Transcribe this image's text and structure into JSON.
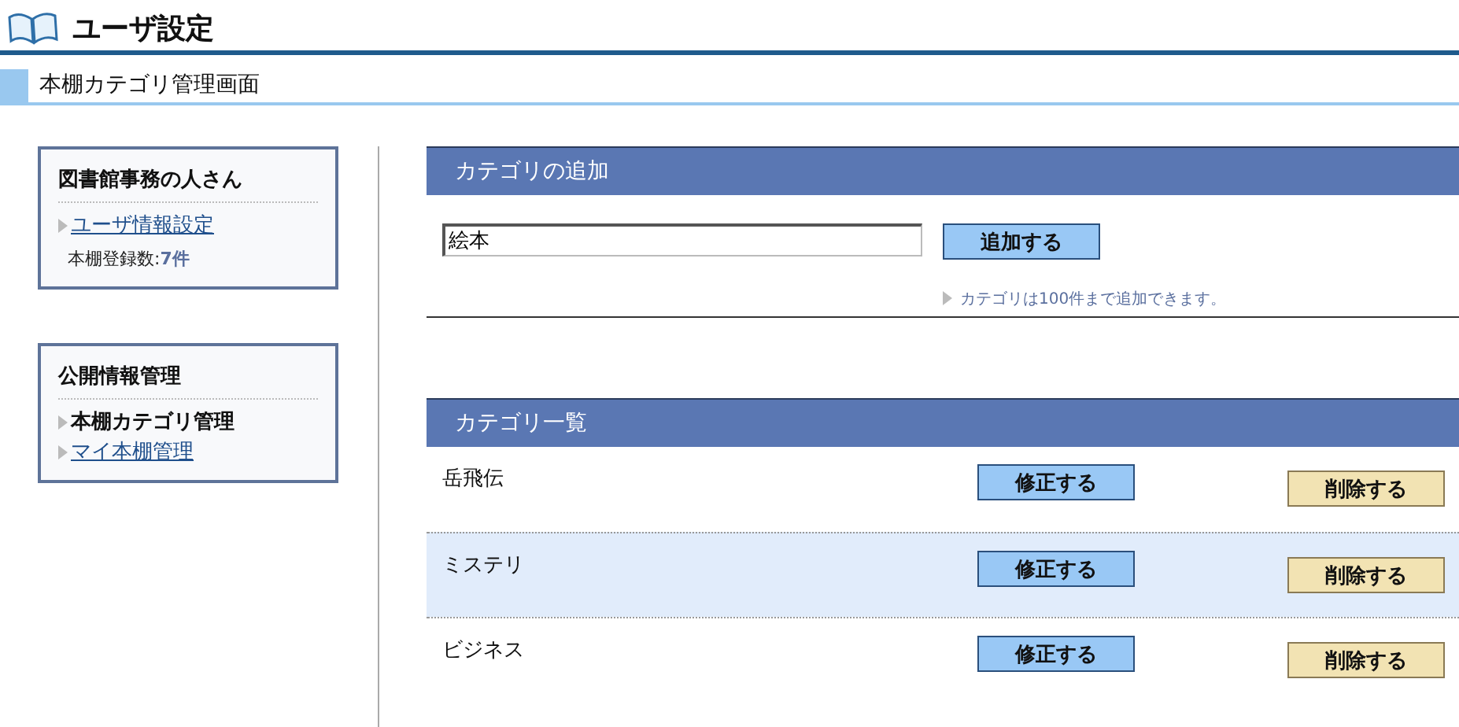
{
  "header": {
    "title": "ユーザ設定"
  },
  "subheader": {
    "title": "本棚カテゴリ管理画面"
  },
  "sidebar": {
    "user_box": {
      "title": "図書館事務の人さん",
      "link": "ユーザ情報設定",
      "count_label": "本棚登録数:",
      "count_value": "7件"
    },
    "public_box": {
      "title": "公開情報管理",
      "items": [
        {
          "label": "本棚カテゴリ管理",
          "selected": true
        },
        {
          "label": "マイ本棚管理",
          "selected": false
        }
      ]
    }
  },
  "add_section": {
    "title": "カテゴリの追加",
    "input_value": "絵本",
    "button": "追加する",
    "note": "カテゴリは100件まで追加できます。"
  },
  "list_section": {
    "title": "カテゴリ一覧",
    "rows": [
      {
        "name": "岳飛伝",
        "edit": "修正する",
        "delete": "削除する",
        "highlighted": false
      },
      {
        "name": "ミステリ",
        "edit": "修正する",
        "delete": "削除する",
        "highlighted": true
      },
      {
        "name": "ビジネス",
        "edit": "修正する",
        "delete": "削除する",
        "highlighted": false
      }
    ]
  }
}
